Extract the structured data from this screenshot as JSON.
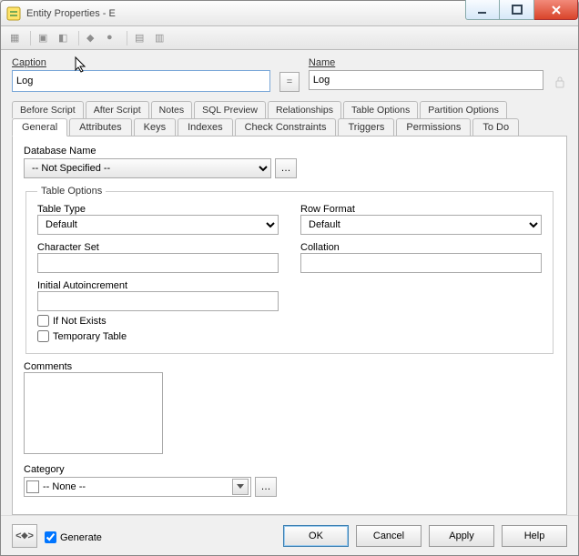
{
  "window": {
    "title": "Entity Properties - E"
  },
  "header": {
    "caption_label": "Caption",
    "caption_value": "Log",
    "equals_label": "=",
    "name_label": "Name",
    "name_value": "Log"
  },
  "tabs_top": [
    "Before Script",
    "After Script",
    "Notes",
    "SQL Preview",
    "Relationships",
    "Table Options",
    "Partition Options"
  ],
  "tabs_bottom": [
    "General",
    "Attributes",
    "Keys",
    "Indexes",
    "Check Constraints",
    "Triggers",
    "Permissions",
    "To Do"
  ],
  "active_tab": "General",
  "general": {
    "database_name_label": "Database Name",
    "database_name_value": "-- Not Specified --",
    "table_options_legend": "Table Options",
    "table_type_label": "Table Type",
    "table_type_value": "Default",
    "row_format_label": "Row Format",
    "row_format_value": "Default",
    "character_set_label": "Character Set",
    "character_set_value": "",
    "collation_label": "Collation",
    "collation_value": "",
    "initial_autoinc_label": "Initial Autoincrement",
    "initial_autoinc_value": "",
    "if_not_exists_label": "If Not Exists",
    "if_not_exists_checked": false,
    "temporary_table_label": "Temporary Table",
    "temporary_table_checked": false,
    "comments_label": "Comments",
    "comments_value": "",
    "category_label": "Category",
    "category_value": "-- None --"
  },
  "footer": {
    "generate_label": "Generate",
    "generate_checked": true,
    "ok": "OK",
    "cancel": "Cancel",
    "apply": "Apply",
    "help": "Help"
  }
}
